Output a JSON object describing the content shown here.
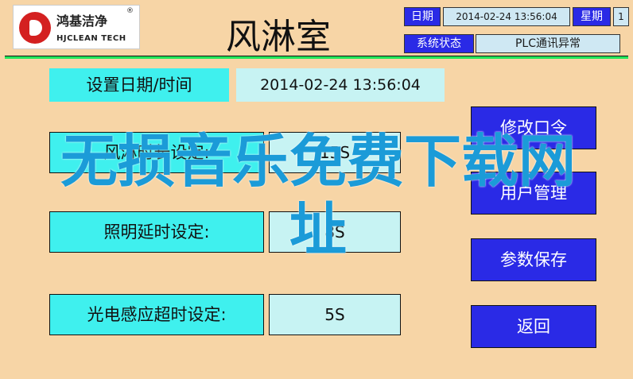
{
  "logo": {
    "name_cn": "鸿基洁净",
    "reg_mark": "®",
    "name_en": "HJCLEAN TECH"
  },
  "title": "风淋室",
  "header": {
    "date_label": "日期",
    "date_value": "2014-02-24 13:56:04",
    "weekday_label": "星期",
    "weekday_value": "1",
    "status_label": "系统状态",
    "status_value": "PLC通讯异常"
  },
  "set_datetime": {
    "label": "设置日期/时间",
    "value": "2014-02-24  13:56:04"
  },
  "settings": [
    {
      "label": "风淋时长设定:",
      "value": "15S"
    },
    {
      "label": "照明延时设定:",
      "value": "8S"
    },
    {
      "label": "光电感应超时设定:",
      "value": "5S"
    }
  ],
  "buttons": {
    "change_password": "修改口令",
    "user_management": "用户管理",
    "save_params": "参数保存",
    "back": "返回"
  },
  "watermark": {
    "line1": "无损音乐免费下载网",
    "line2": "址"
  },
  "colors": {
    "background": "#f7d5a6",
    "accent_blue": "#2a2ae6",
    "cyan": "#3ff0ee",
    "divider_green": "#23e65a",
    "watermark": "#1b9bd8"
  }
}
